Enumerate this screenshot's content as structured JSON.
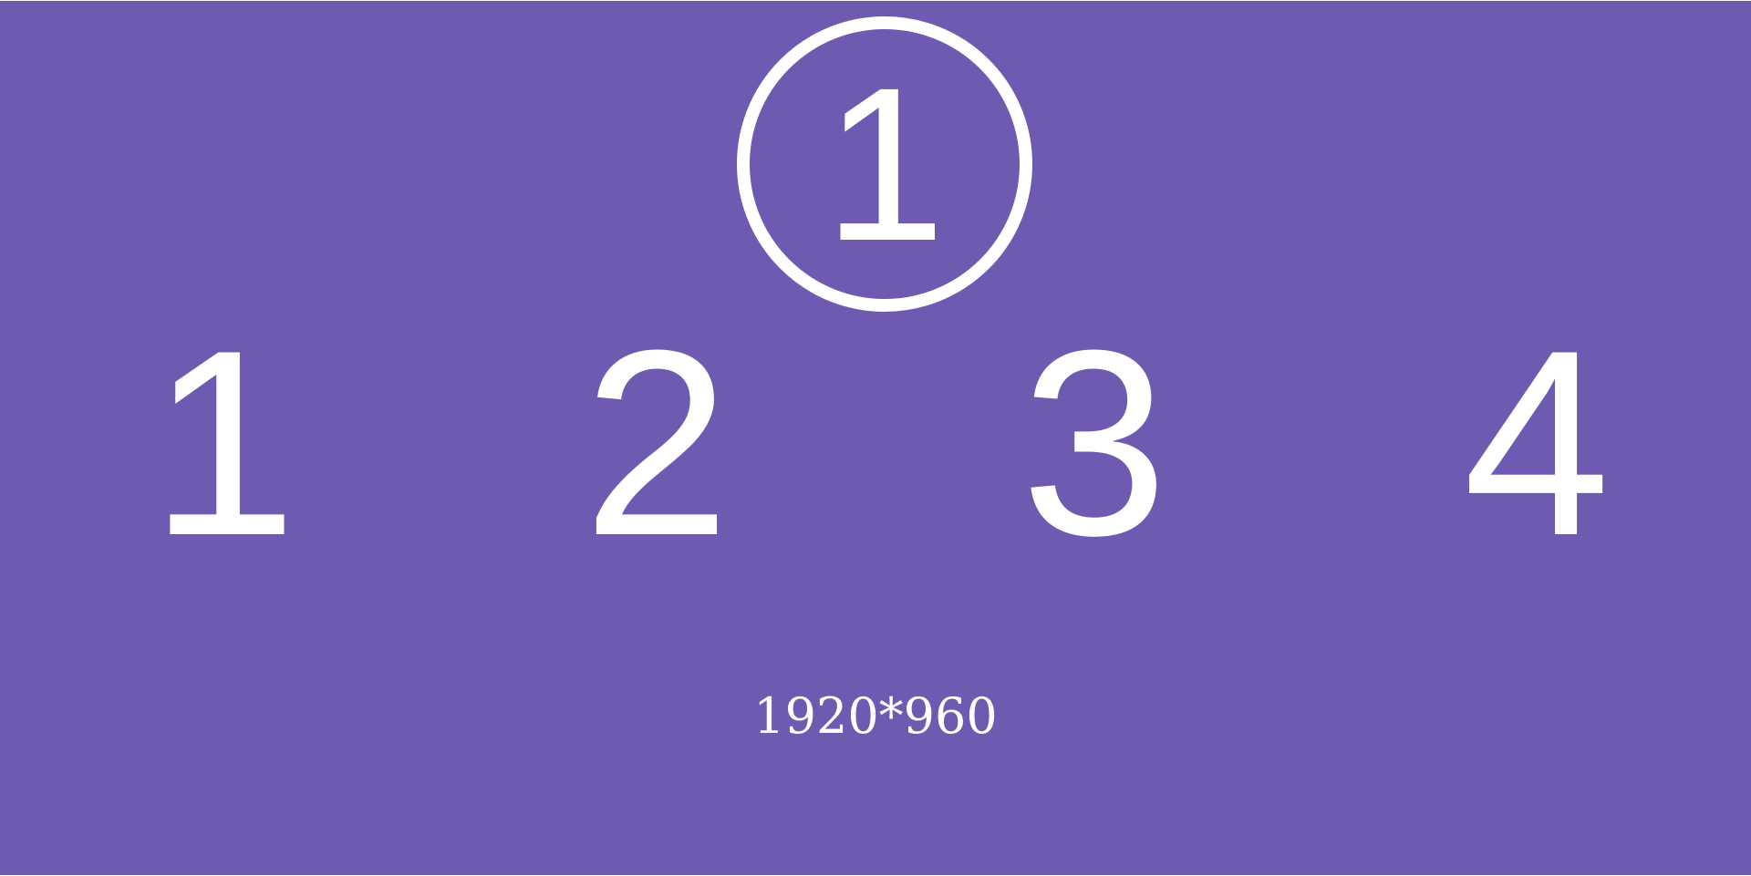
{
  "badge": {
    "number": "1"
  },
  "digits": [
    "1",
    "2",
    "3",
    "4"
  ],
  "resolution": "1920*960",
  "colors": {
    "background": "#6e5bb1",
    "foreground": "#ffffff"
  }
}
